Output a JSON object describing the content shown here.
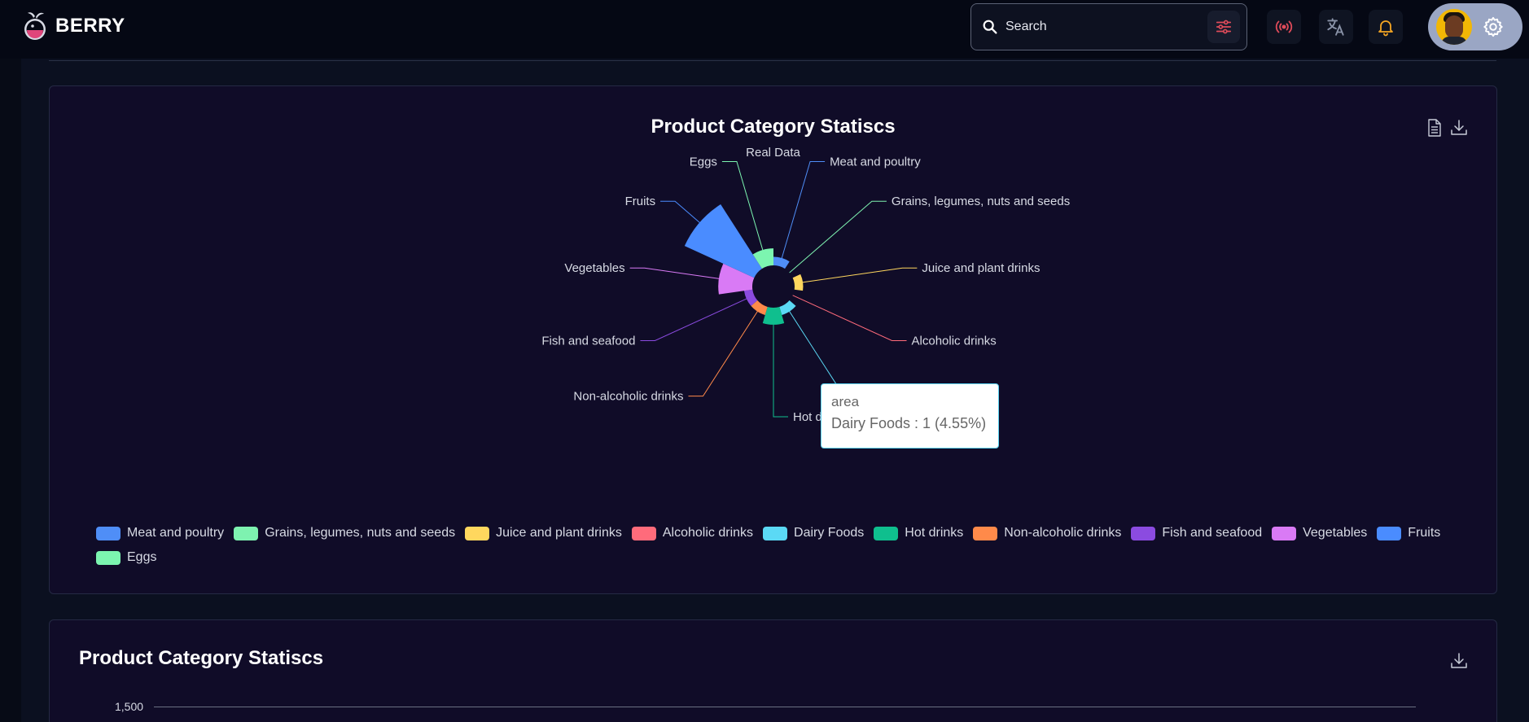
{
  "app": {
    "name": "BERRY"
  },
  "search": {
    "placeholder": "Search"
  },
  "header_icons": [
    "broadcast-icon",
    "translate-icon",
    "bell-icon",
    "avatar",
    "gear-icon"
  ],
  "colors": {
    "broadcast": "#e04b5a",
    "notification": "#f5a623",
    "filter": "#e04b5a"
  },
  "card1": {
    "title": "Product Category Statiscs",
    "subtitle": "Real Data",
    "tools": [
      "document-icon",
      "download-icon"
    ]
  },
  "chart_data": {
    "type": "pie",
    "variant": "rose",
    "title": "Product Category Statiscs",
    "subtitle": "Real Data",
    "categories": [
      "Meat and poultry",
      "Grains, legumes, nuts and seeds",
      "Juice and plant drinks",
      "Alcoholic drinks",
      "Dairy Foods",
      "Hot drinks",
      "Non-alcoholic drinks",
      "Fish and seafood",
      "Vegetables",
      "Fruits",
      "Eggs"
    ],
    "slice_labels": [
      "Meat and poultry",
      "Grains, legumes, nuts and seeds",
      "Juice and plant drinks",
      "Alcoholic drinks",
      "Dairy Foods",
      "Hot drinks",
      "Non-alcoholic drinks",
      "Fish and seafood",
      "Vegetables",
      "Fruits",
      "Eggs"
    ],
    "values": [
      1,
      0,
      1,
      0,
      1,
      2,
      1,
      1,
      4,
      9,
      2
    ],
    "colors": [
      "#4f8ef7",
      "#7ef2b0",
      "#ffd75e",
      "#ff6b7b",
      "#5bd9f5",
      "#0fbf8e",
      "#ff8a4a",
      "#8b4be0",
      "#d97af5",
      "#4a8cff",
      "#7cf5b0"
    ],
    "legend_position": "bottom",
    "tooltip": {
      "series": "area",
      "text": "Dairy Foods : 1 (4.55%)"
    }
  },
  "card2": {
    "title": "Product Category Statiscs",
    "tools": [
      "download-icon"
    ],
    "y_tick": "1,500"
  }
}
